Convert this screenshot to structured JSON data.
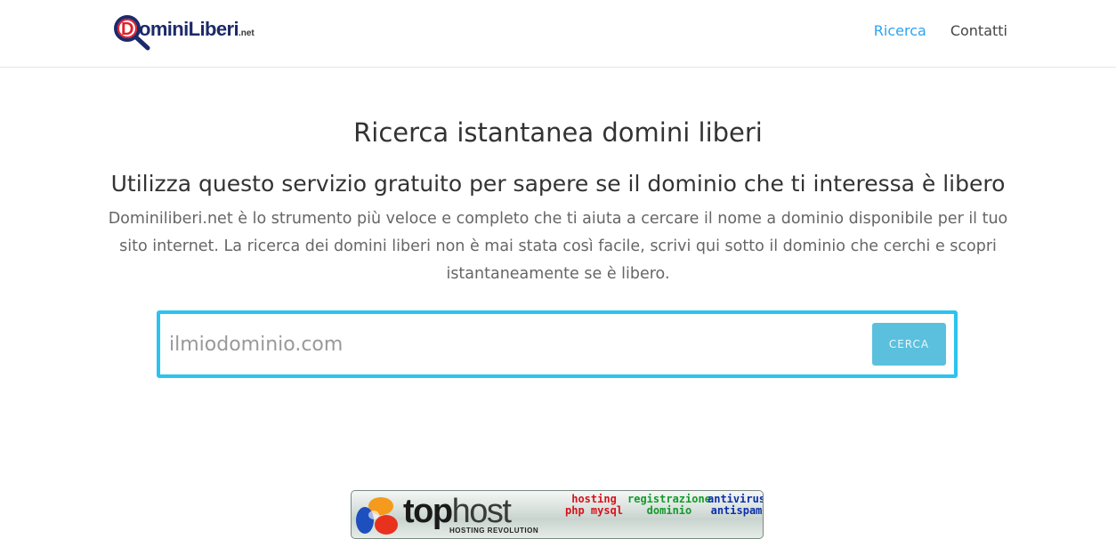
{
  "header": {
    "logo": {
      "initial": "D",
      "rest": "ominiLiberi",
      "tld": ".net"
    },
    "nav": [
      {
        "label": "Ricerca",
        "active": true
      },
      {
        "label": "Contatti",
        "active": false
      }
    ]
  },
  "main": {
    "title": "Ricerca istantanea domini liberi",
    "subtitle": "Utilizza questo servizio gratuito per sapere se il dominio che ti interessa è libero",
    "description": "Dominiliberi.net è lo strumento più veloce e completo che ti aiuta a cercare il nome a dominio disponibile per il tuo sito internet. La ricerca dei domini liberi non è mai stata così facile, scrivi qui sotto il dominio che cerchi e scopri istantaneamente se è libero."
  },
  "search": {
    "placeholder": "ilmiodominio.com",
    "value": "",
    "button_label": "CERCA"
  },
  "banner": {
    "brand_bold": "top",
    "brand_light": "host",
    "tagline": "HOSTING REVOLUTION",
    "col1": [
      "hosting",
      "php mysql"
    ],
    "col2": [
      "registrazione",
      "dominio"
    ],
    "col3": [
      "antivirus",
      "antispam"
    ]
  },
  "colors": {
    "accent": "#2ea3f2",
    "search_border": "#2bc3f0",
    "button": "#5bc0de",
    "logo_red": "#e0202c",
    "logo_blue": "#1c2a6b"
  }
}
